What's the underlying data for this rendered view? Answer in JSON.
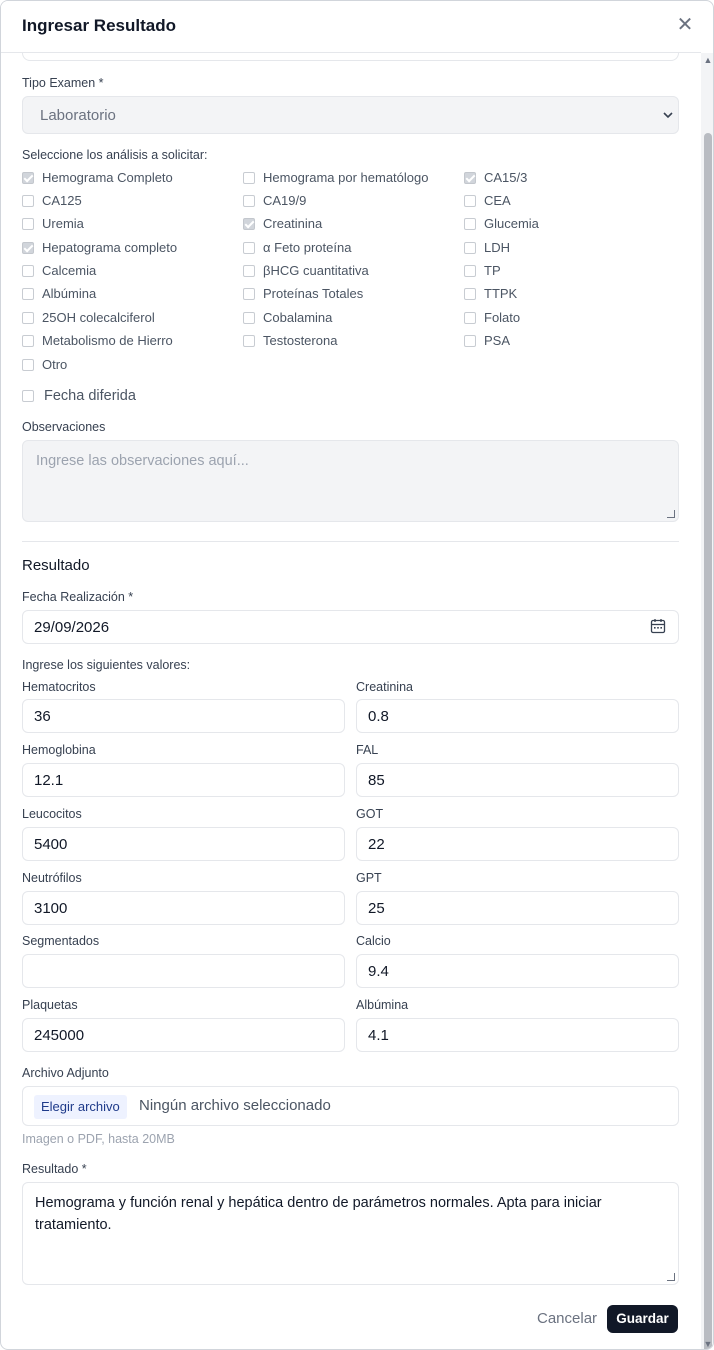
{
  "modal": {
    "title": "Ingresar Resultado",
    "close_icon": "close-icon"
  },
  "tipo_examen": {
    "label": "Tipo Examen *",
    "value": "Laboratorio"
  },
  "analisis": {
    "label": "Seleccione los análisis a solicitar:",
    "items": [
      {
        "label": "Hemograma Completo",
        "checked": true
      },
      {
        "label": "Hemograma por hematólogo",
        "checked": false
      },
      {
        "label": "CA15/3",
        "checked": true
      },
      {
        "label": "CA125",
        "checked": false
      },
      {
        "label": "CA19/9",
        "checked": false
      },
      {
        "label": "CEA",
        "checked": false
      },
      {
        "label": "Uremia",
        "checked": false
      },
      {
        "label": "Creatinina",
        "checked": true
      },
      {
        "label": "Glucemia",
        "checked": false
      },
      {
        "label": "Hepatograma completo",
        "checked": true
      },
      {
        "label": "α Feto proteína",
        "checked": false
      },
      {
        "label": "LDH",
        "checked": false
      },
      {
        "label": "Calcemia",
        "checked": false
      },
      {
        "label": "βHCG cuantitativa",
        "checked": false
      },
      {
        "label": "TP",
        "checked": false
      },
      {
        "label": "Albúmina",
        "checked": false
      },
      {
        "label": "Proteínas Totales",
        "checked": false
      },
      {
        "label": "TTPK",
        "checked": false
      },
      {
        "label": "25OH colecalciferol",
        "checked": false
      },
      {
        "label": "Cobalamina",
        "checked": false
      },
      {
        "label": "Folato",
        "checked": false
      },
      {
        "label": "Metabolismo de Hierro",
        "checked": false
      },
      {
        "label": "Testosterona",
        "checked": false
      },
      {
        "label": "PSA",
        "checked": false
      },
      {
        "label": "Otro",
        "checked": false
      }
    ]
  },
  "fecha_diferida": {
    "label": "Fecha diferida",
    "checked": false
  },
  "observaciones": {
    "label": "Observaciones",
    "placeholder": "Ingrese las observaciones aquí..."
  },
  "resultado_section": {
    "title": "Resultado",
    "fecha_label": "Fecha Realización *",
    "fecha_value": "29/09/2026",
    "values_label": "Ingrese los siguientes valores:"
  },
  "valores": [
    {
      "label": "Hematocritos",
      "value": "36"
    },
    {
      "label": "Creatinina",
      "value": "0.8"
    },
    {
      "label": "Hemoglobina",
      "value": "12.1"
    },
    {
      "label": "FAL",
      "value": "85"
    },
    {
      "label": "Leucocitos",
      "value": "5400"
    },
    {
      "label": "GOT",
      "value": "22"
    },
    {
      "label": "Neutrófilos",
      "value": "3100"
    },
    {
      "label": "GPT",
      "value": "25"
    },
    {
      "label": "Segmentados",
      "value": ""
    },
    {
      "label": "Calcio",
      "value": "9.4"
    },
    {
      "label": "Plaquetas",
      "value": "245000"
    },
    {
      "label": "Albúmina",
      "value": "4.1"
    }
  ],
  "archivo": {
    "label": "Archivo Adjunto",
    "button": "Elegir archivo",
    "status": "Ningún archivo seleccionado",
    "hint": "Imagen o PDF, hasta 20MB"
  },
  "resultado": {
    "label": "Resultado *",
    "value": "Hemograma y función renal y hepática dentro de parámetros normales. Apta para iniciar tratamiento."
  },
  "actions": {
    "cancel": "Cancelar",
    "save": "Guardar"
  },
  "colors": {
    "primary": "#111827",
    "muted_bg": "#f3f4f6",
    "border": "#e5e7eb",
    "file_button_bg": "#eef2ff"
  }
}
